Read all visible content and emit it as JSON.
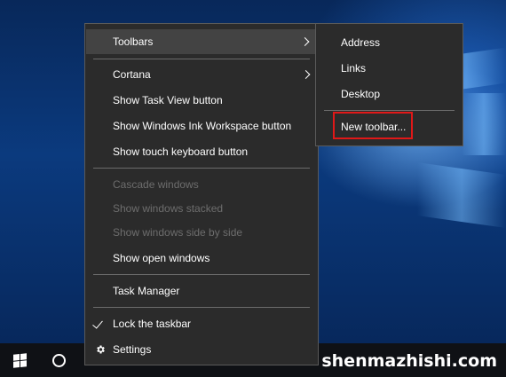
{
  "context_menu": {
    "items": [
      {
        "label": "Toolbars"
      },
      {
        "label": "Cortana"
      },
      {
        "label": "Show Task View button"
      },
      {
        "label": "Show Windows Ink Workspace button"
      },
      {
        "label": "Show touch keyboard button"
      },
      {
        "label": "Cascade windows"
      },
      {
        "label": "Show windows stacked"
      },
      {
        "label": "Show windows side by side"
      },
      {
        "label": "Show open windows"
      },
      {
        "label": "Task Manager"
      },
      {
        "label": "Lock the taskbar"
      },
      {
        "label": "Settings"
      }
    ]
  },
  "toolbars_submenu": {
    "items": [
      {
        "label": "Address"
      },
      {
        "label": "Links"
      },
      {
        "label": "Desktop"
      },
      {
        "label": "New toolbar..."
      }
    ]
  },
  "watermark": "shenmazhishi.com",
  "colors": {
    "menu_bg": "#2b2b2b",
    "hover_bg": "#434343",
    "disabled_text": "#6d6d6d",
    "highlight_border": "#e01818",
    "taskbar_bg": "#0f1115"
  }
}
